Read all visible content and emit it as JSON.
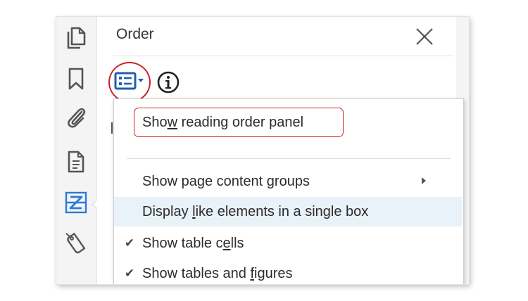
{
  "panel": {
    "title": "Order"
  },
  "rail": {
    "items": [
      {
        "icon": "pages-icon"
      },
      {
        "icon": "bookmark-icon"
      },
      {
        "icon": "attachment-icon"
      },
      {
        "icon": "document-icon"
      },
      {
        "icon": "reading-order-icon",
        "active": true
      },
      {
        "icon": "tag-icon"
      }
    ]
  },
  "colors": {
    "accent": "#2c7ad6",
    "callout": "#c8282e",
    "highlight": "#e9f1f9"
  },
  "menu": {
    "items": [
      {
        "pre": "Sho",
        "key": "w",
        "post": " reading order panel",
        "checked": false
      },
      {
        "pre": "Show page content ",
        "key": "g",
        "post": "roups",
        "checked": false,
        "submenu": true
      },
      {
        "pre": "Display ",
        "key": "l",
        "post": "ike elements in a single box",
        "checked": false,
        "highlighted": true
      },
      {
        "pre": "Show table c",
        "key": "e",
        "post": "lls",
        "checked": true,
        "check_mark": "✔"
      },
      {
        "pre": "Show tables and ",
        "key": "f",
        "post": "igures",
        "checked": true,
        "check_mark": "✔"
      }
    ]
  }
}
